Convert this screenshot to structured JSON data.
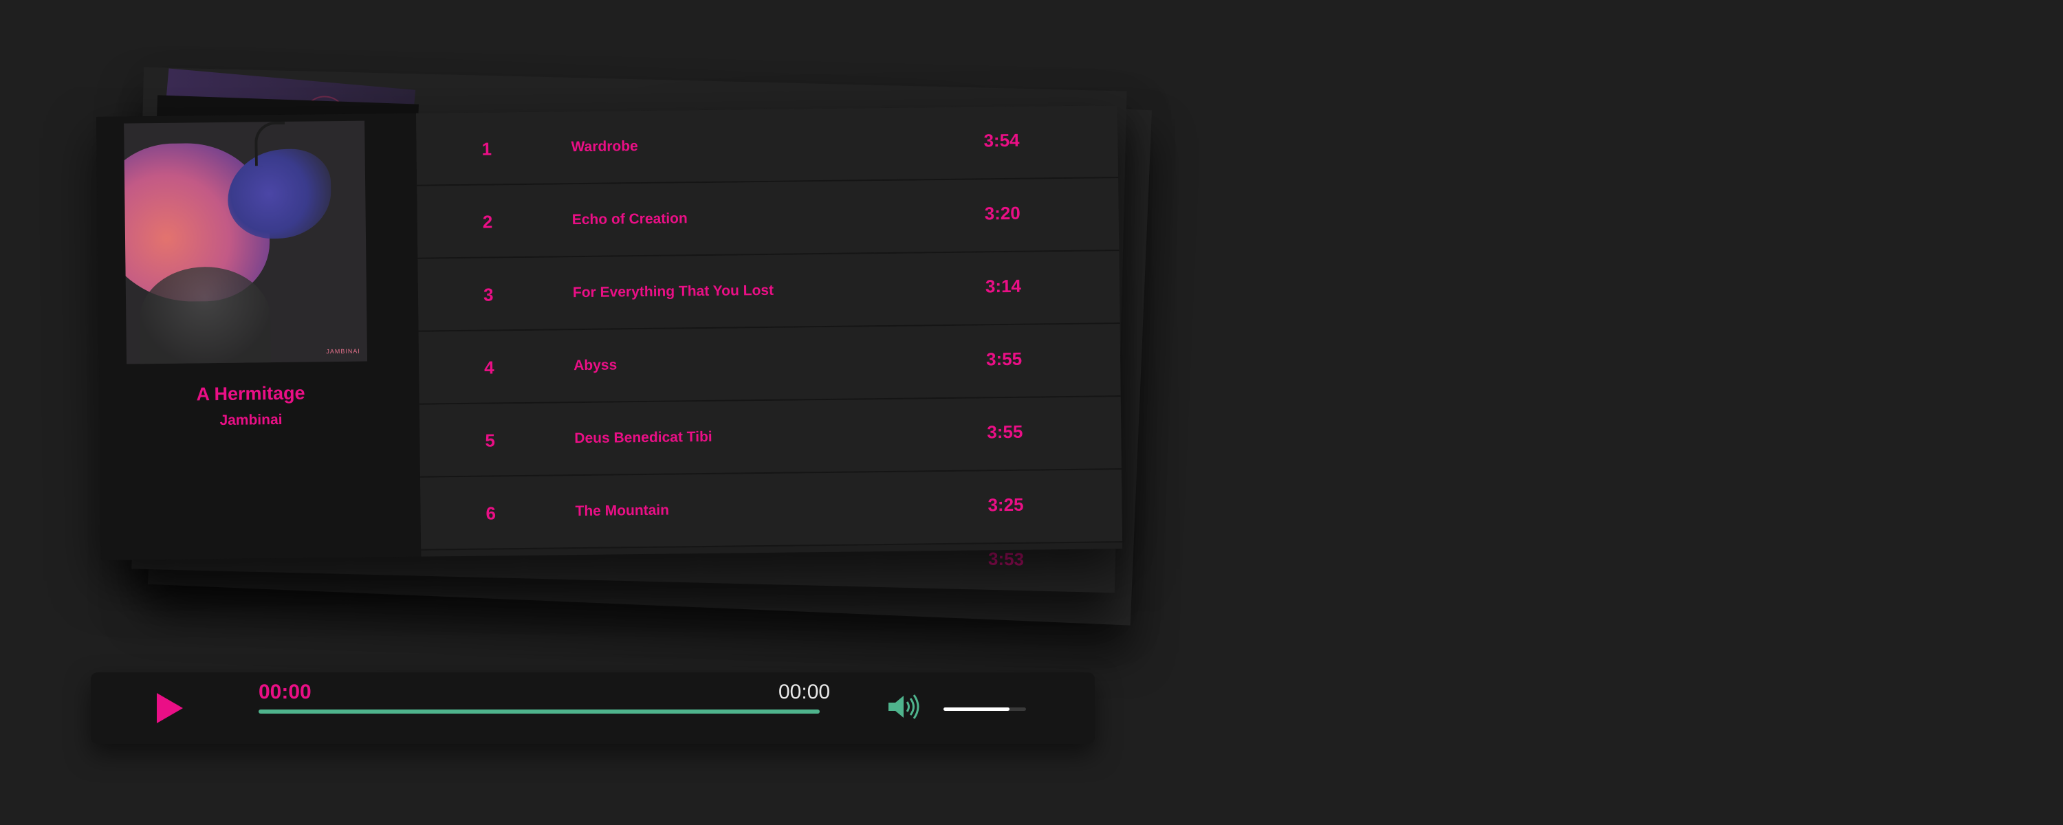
{
  "album": {
    "title": "A Hermitage",
    "artist": "Jambinai",
    "cover_band_text": "JAMBINAI"
  },
  "tracks": [
    {
      "number": "1",
      "title": "Wardrobe",
      "duration": "3:54"
    },
    {
      "number": "2",
      "title": "Echo of Creation",
      "duration": "3:20"
    },
    {
      "number": "3",
      "title": "For Everything That You Lost",
      "duration": "3:14"
    },
    {
      "number": "4",
      "title": "Abyss",
      "duration": "3:55"
    },
    {
      "number": "5",
      "title": "Deus Benedicat Tibi",
      "duration": "3:55"
    },
    {
      "number": "6",
      "title": "The Mountain",
      "duration": "3:25"
    }
  ],
  "partially_visible_duration": "3:53",
  "player": {
    "current_time": "00:00",
    "total_time": "00:00",
    "progress_fraction": 1.0,
    "volume_fraction": 0.8,
    "play_icon": "play-icon",
    "volume_icon": "speaker-volume-icon"
  },
  "colors": {
    "accent": "#ea0f86",
    "progress": "#4fb48d",
    "background": "#1f1f1f"
  }
}
